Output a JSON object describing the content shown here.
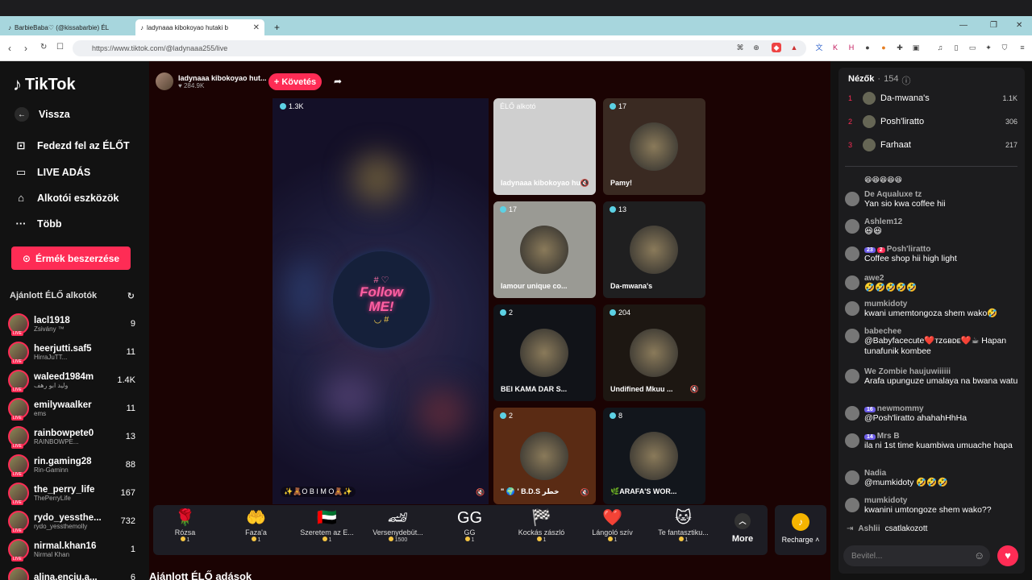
{
  "browser": {
    "tabs": [
      {
        "title": "BarbieBaba♡ (@kissabarbie) ÉL"
      },
      {
        "title": "ladynaaa kibokoyao hutaki b"
      }
    ],
    "url": "https://www.tiktok.com/@ladynaaa255/live"
  },
  "sidebar": {
    "brand": "TikTok",
    "nav": [
      {
        "label": "Vissza",
        "icon": "back-arrow-icon"
      },
      {
        "label": "Fedezd fel az ÉLŐT",
        "icon": "explore-icon"
      },
      {
        "label": "LIVE ADÁS",
        "icon": "video-camera-icon"
      },
      {
        "label": "Alkotói eszközök",
        "icon": "creator-tools-icon"
      },
      {
        "label": "Több",
        "icon": "more-dots-icon"
      }
    ],
    "coins_button": "Érmék beszerzése",
    "recommended_title": "Ajánlott ÉLŐ alkotók",
    "creators": [
      {
        "name": "lacl1918",
        "sub": "Zsivány ™",
        "count": "9"
      },
      {
        "name": "heerjutti.saf5",
        "sub": "HirraJuTT...",
        "count": "11"
      },
      {
        "name": "waleed1984m",
        "sub": "وليد ابو رهف",
        "count": "1.4K"
      },
      {
        "name": "emilywaalker",
        "sub": "ems",
        "count": "11"
      },
      {
        "name": "rainbowpete0",
        "sub": "RAINBOWPE...",
        "count": "13"
      },
      {
        "name": "rin.gaming28",
        "sub": "Rin-Gaminn",
        "count": "88"
      },
      {
        "name": "the_perry_life",
        "sub": "ThePerryLife",
        "count": "167"
      },
      {
        "name": "rydo_yessthe...",
        "sub": "rydo_yessthemolly",
        "count": "732"
      },
      {
        "name": "nirmal.khan16",
        "sub": "Nirmal Khan",
        "count": "1"
      },
      {
        "name": "alina.enciu.a...",
        "sub": "",
        "count": "6"
      }
    ],
    "live_badge": "LIVE"
  },
  "stream": {
    "host_name": "ladynaaa kibokoyao hut...",
    "host_likes": "284.9K",
    "follow_button": "+ Követés",
    "main_viewers": "1.3K",
    "main_label": "✨🧸O B I M O🧸✨",
    "follow_text": "Follow ME!",
    "tiles": [
      {
        "viewers": "ÉLŐ alkotó",
        "name": "ladynaaa kibokoyao hut:",
        "bg": "#cfcfcf",
        "muted": true,
        "dot": false
      },
      {
        "viewers": "17",
        "name": "Pamy!",
        "bg": "#3a2a22",
        "muted": false,
        "dot": true
      },
      {
        "viewers": "17",
        "name": "lamour unique co...",
        "bg": "#9a9a94",
        "muted": false,
        "dot": true
      },
      {
        "viewers": "13",
        "name": "Da-mwana's",
        "bg": "#1f1f20",
        "muted": false,
        "dot": true
      },
      {
        "viewers": "2",
        "name": "BEI KAMA DAR S...",
        "bg": "#111318",
        "muted": false,
        "dot": true
      },
      {
        "viewers": "204",
        "name": "Undifined Mkuu ...",
        "bg": "#1d1712",
        "muted": true,
        "dot": true
      },
      {
        "viewers": "2",
        "name": "\" 🌍 ' B.D.S خطر",
        "bg": "#5a2b14",
        "muted": true,
        "dot": true
      },
      {
        "viewers": "8",
        "name": "🌿ARAFA'S WOR...",
        "bg": "#12161c",
        "muted": false,
        "dot": true
      }
    ]
  },
  "gifts": [
    {
      "name": "Rózsa",
      "price": "1",
      "icon": "🌹"
    },
    {
      "name": "Faza'a",
      "price": "1",
      "icon": "🤲"
    },
    {
      "name": "Szeretem az E...",
      "price": "1",
      "icon": "🇦🇪"
    },
    {
      "name": "Versenydebüt...",
      "price": "1500",
      "icon": "🏎"
    },
    {
      "name": "GG",
      "price": "1",
      "icon": "GG"
    },
    {
      "name": "Kockás zászló",
      "price": "1",
      "icon": "🏁"
    },
    {
      "name": "Lángoló szív",
      "price": "1",
      "icon": "❤️"
    },
    {
      "name": "Te fantasztiku...",
      "price": "1",
      "icon": "🐱"
    }
  ],
  "gift_more": "More",
  "recharge": "Recharge",
  "recommended_streams": "Ajánlott ÉLŐ adások",
  "chat": {
    "viewers_title": "Nézők",
    "viewers_count": "154",
    "top_viewers": [
      {
        "rank": "1",
        "name": "Da-mwana's",
        "score": "1.1K"
      },
      {
        "rank": "2",
        "name": "Posh'liratto",
        "score": "306"
      },
      {
        "rank": "3",
        "name": "Farhaat",
        "score": "217"
      }
    ],
    "messages": [
      {
        "user": "De Aqualuxe tz",
        "text": "Yan sio kwa coffee hii"
      },
      {
        "user": "Ashlem12",
        "text": "😆😆"
      },
      {
        "user": "Posh'liratto",
        "text": "Coffee shop hii high light",
        "badges": [
          "23",
          "2"
        ]
      },
      {
        "user": "awe2",
        "text": "🤣🤣🤣🤣🤣"
      },
      {
        "user": "mumkidoty",
        "text": "kwani umemtongoza shem wako🤣"
      },
      {
        "user": "babechee",
        "text": "@Babyfacecute❤️ᴛᴢɢʙᴅᴇ❤️☕ Hapan tunafunik kombee"
      },
      {
        "user": "We Zombie haujuwiiiiii",
        "text": "Arafa upunguze umalaya na bwana watu"
      },
      {
        "user": "newmommy",
        "text": "@Posh'liratto ahahahHhHa",
        "badges": [
          "16"
        ]
      },
      {
        "user": "Mrs B",
        "text": "ila ni 1st time kuambiwa umuache hapa",
        "badges": [
          "14"
        ]
      },
      {
        "user": "Nadia",
        "text": "@mumkidoty 🤣🤣🤣"
      },
      {
        "user": "mumkidoty",
        "text": "kwanini umtongoze shem wako??"
      }
    ],
    "join_user": "Ashlii",
    "join_text": "csatlakozott",
    "input_placeholder": "Bevitel..."
  },
  "colors": {
    "accent": "#fe2c55",
    "stage_bg": "#1b0303"
  }
}
